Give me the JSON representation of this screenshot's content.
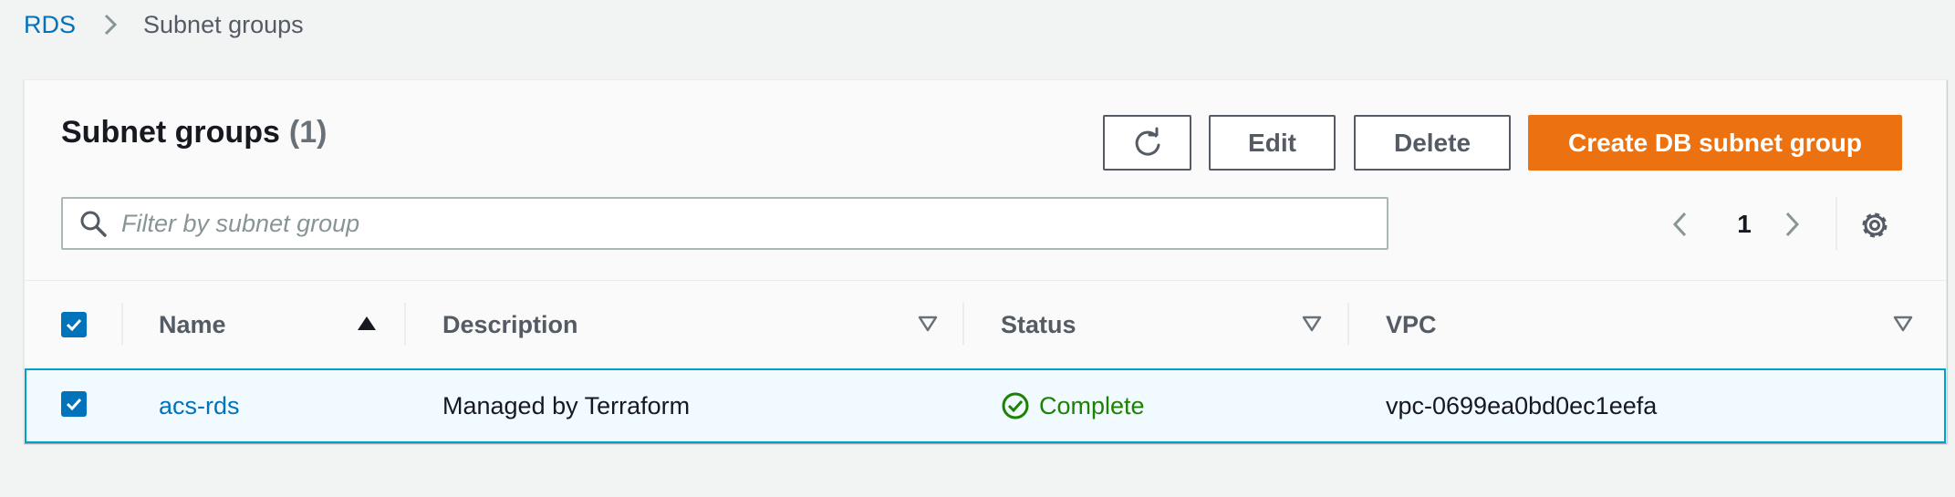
{
  "breadcrumb": {
    "root": "RDS",
    "current": "Subnet groups"
  },
  "header": {
    "title": "Subnet groups",
    "count": "(1)"
  },
  "actions": {
    "edit_label": "Edit",
    "delete_label": "Delete",
    "create_label": "Create DB subnet group"
  },
  "search": {
    "placeholder": "Filter by subnet group",
    "value": ""
  },
  "pagination": {
    "current_page": "1"
  },
  "table": {
    "columns": [
      "Name",
      "Description",
      "Status",
      "VPC"
    ],
    "name_sort": "ascending",
    "rows": [
      {
        "selected": true,
        "name": "acs-rds",
        "description": "Managed by Terraform",
        "status": "Complete",
        "vpc": "vpc-0699ea0bd0ec1eefa"
      }
    ]
  },
  "colors": {
    "link": "#0073bb",
    "primary_button": "#ec7211",
    "status_success": "#1d8102",
    "selected_row_bg": "#f1faff",
    "selected_row_border": "#00a1c9"
  }
}
